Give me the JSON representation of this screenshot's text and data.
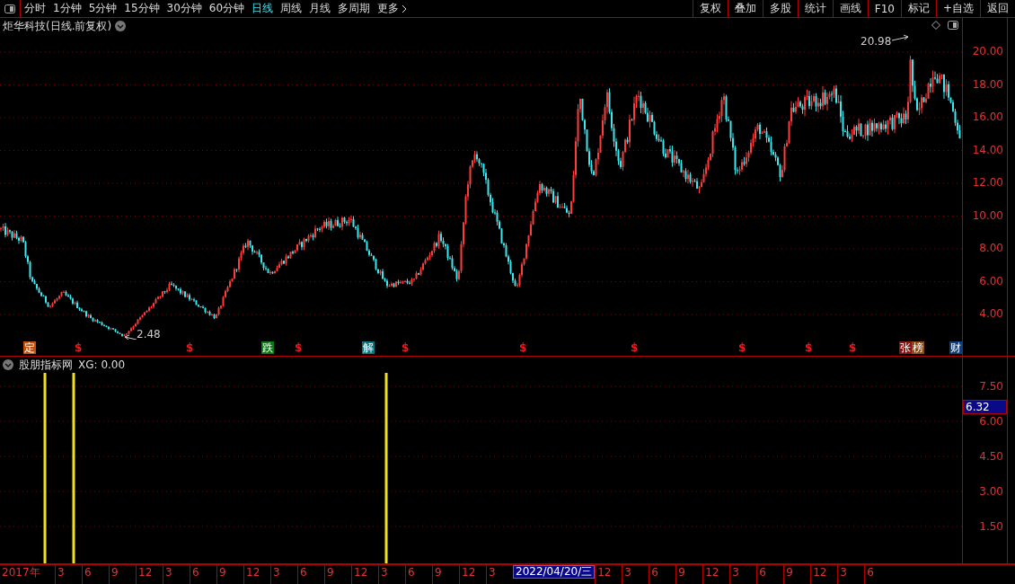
{
  "toolbar": {
    "periods": [
      {
        "label": "分时",
        "selected": false
      },
      {
        "label": "1分钟",
        "selected": false
      },
      {
        "label": "5分钟",
        "selected": false
      },
      {
        "label": "15分钟",
        "selected": false
      },
      {
        "label": "30分钟",
        "selected": false
      },
      {
        "label": "60分钟",
        "selected": false
      },
      {
        "label": "日线",
        "selected": true
      },
      {
        "label": "周线",
        "selected": false
      },
      {
        "label": "月线",
        "selected": false
      },
      {
        "label": "多周期",
        "selected": false
      }
    ],
    "more": "更多",
    "buttons": [
      "复权",
      "叠加",
      "多股",
      "统计",
      "画线",
      "F10",
      "标记",
      "+自选",
      "返回"
    ]
  },
  "main_chart": {
    "title": "炬华科技(日线.前复权)",
    "high_label": "20.98",
    "low_label": "2.48",
    "price_axis": [
      "20.00",
      "18.00",
      "16.00",
      "14.00",
      "12.00",
      "10.00",
      "8.00",
      "6.00",
      "4.00"
    ],
    "markers": [
      {
        "kind": "badge",
        "text": "定",
        "color": "#c0500a"
      },
      {
        "kind": "dollar",
        "text": "$"
      },
      {
        "kind": "dollar",
        "text": "$"
      },
      {
        "kind": "badge",
        "text": "跌",
        "color": "#0a7a14"
      },
      {
        "kind": "dollar",
        "text": "$"
      },
      {
        "kind": "badge",
        "text": "解",
        "color": "#0a7480"
      },
      {
        "kind": "dollar",
        "text": "$"
      },
      {
        "kind": "dollar",
        "text": "$"
      },
      {
        "kind": "dollar",
        "text": "$"
      },
      {
        "kind": "dollar",
        "text": "$"
      },
      {
        "kind": "dollar",
        "text": "$"
      },
      {
        "kind": "dollar",
        "text": "$"
      },
      {
        "kind": "badge",
        "text": "张",
        "color": "#8a1414"
      },
      {
        "kind": "badge",
        "text": "榜",
        "color": "#8a4a10"
      },
      {
        "kind": "badge",
        "text": "财",
        "color": "#103c78"
      }
    ]
  },
  "indicator": {
    "name": "股朋指标网",
    "value": "XG: 0.00",
    "axis": [
      "7.50",
      "6.00",
      "4.50",
      "3.00",
      "1.50"
    ],
    "cursor_value": "6.32"
  },
  "time_axis": [
    {
      "kind": "tick",
      "text": "2017年"
    },
    {
      "kind": "tick",
      "text": "3"
    },
    {
      "kind": "tick",
      "text": "6"
    },
    {
      "kind": "tick",
      "text": "9"
    },
    {
      "kind": "tick",
      "text": "12"
    },
    {
      "kind": "tick",
      "text": "3"
    },
    {
      "kind": "tick",
      "text": "6"
    },
    {
      "kind": "tick",
      "text": "9"
    },
    {
      "kind": "tick",
      "text": "12"
    },
    {
      "kind": "tick",
      "text": "3"
    },
    {
      "kind": "tick",
      "text": "6"
    },
    {
      "kind": "tick",
      "text": "9"
    },
    {
      "kind": "tick",
      "text": "12"
    },
    {
      "kind": "tick",
      "text": "3"
    },
    {
      "kind": "tick",
      "text": "6"
    },
    {
      "kind": "tick",
      "text": "9"
    },
    {
      "kind": "tick",
      "text": "12"
    },
    {
      "kind": "tick",
      "text": "3"
    },
    {
      "kind": "cursor",
      "text": "2022/04/20/三"
    },
    {
      "kind": "tick",
      "text": "12"
    },
    {
      "kind": "tick",
      "text": "3"
    },
    {
      "kind": "tick",
      "text": "6"
    },
    {
      "kind": "tick",
      "text": "9"
    },
    {
      "kind": "tick",
      "text": "12"
    },
    {
      "kind": "tick",
      "text": "3"
    },
    {
      "kind": "tick",
      "text": "6"
    },
    {
      "kind": "tick",
      "text": "9"
    },
    {
      "kind": "tick",
      "text": "12"
    },
    {
      "kind": "tick",
      "text": "3"
    },
    {
      "kind": "tick",
      "text": "6"
    }
  ]
}
